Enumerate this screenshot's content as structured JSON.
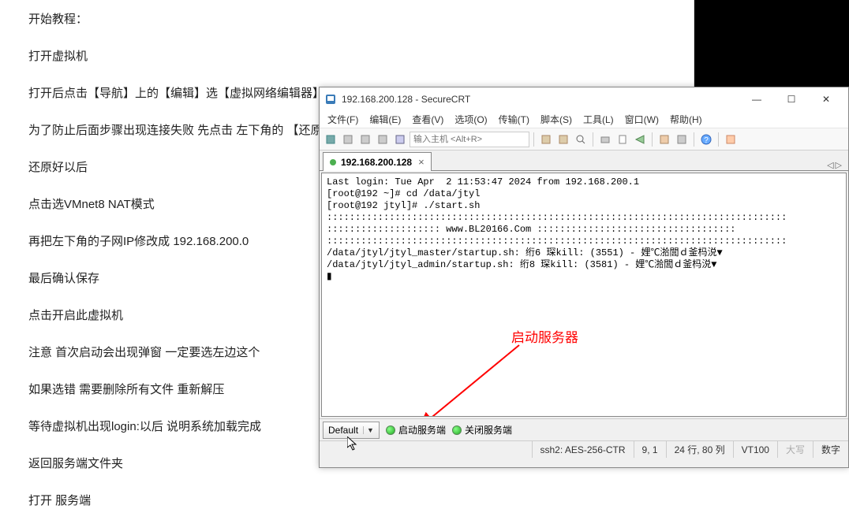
{
  "instructions": [
    "开始教程：",
    "打开虚拟机",
    "打开后点击【导航】上的【编辑】选【虚拟网络编辑器】",
    "为了防止后面步骤出现连接失败 先点击 左下角的 【还原",
    "还原好以后",
    "点击选VMnet8 NAT模式",
    "再把左下角的子网IP修改成 192.168.200.0",
    "最后确认保存",
    "点击开启此虚拟机",
    "注意 首次启动会出现弹窗 一定要选左边这个",
    "如果选错 需要删除所有文件 重新解压",
    "等待虚拟机出现login:以后 说明系统加载完成",
    "返回服务端文件夹",
    "打开 服务端"
  ],
  "window": {
    "title": "192.168.200.128 - SecureCRT"
  },
  "menu": {
    "file": "文件(F)",
    "edit": "编辑(E)",
    "view": "查看(V)",
    "options": "选项(O)",
    "transfer": "传输(T)",
    "script": "脚本(S)",
    "tools": "工具(L)",
    "window": "窗口(W)",
    "help": "帮助(H)"
  },
  "toolbar": {
    "host_placeholder": "输入主机 <Alt+R>"
  },
  "tab": {
    "title": "192.168.200.128"
  },
  "terminal": {
    "line1": "Last login: Tue Apr  2 11:53:47 2024 from 192.168.200.1",
    "line2": "[root@192 ~]# cd /data/jtyl",
    "line3": "[root@192 jtyl]# ./start.sh",
    "line4": ":::::::::::::::::::::::::::::::::::::::::::::::::::::::::::::::::::::::::::::::::",
    "line5": ":::::::::::::::::::: www.BL20166.Com :::::::::::::::::::::::::::::::::::",
    "line6": ":::::::::::::::::::::::::::::::::::::::::::::::::::::::::::::::::::::::::::::::::",
    "line7": "/data/jtyl/jtyl_master/startup.sh: 绗6 琛kill: (3551) - 娌℃湁閭ｄ釜杩涚▼",
    "line8": "/data/jtyl/jtyl_admin/startup.sh: 绗8 琛kill: (3581) - 娌℃湁閭ｄ釜杩涚▼",
    "cursor": "▮"
  },
  "annotation": "启动服务器",
  "bottombar": {
    "default": "Default",
    "start": "启动服务端",
    "stop": "关闭服务端"
  },
  "statusbar": {
    "proto": "ssh2: AES-256-CTR",
    "pos": "9,  1",
    "size": "24 行, 80 列",
    "term": "VT100",
    "caps": "大写",
    "num": "数字"
  }
}
